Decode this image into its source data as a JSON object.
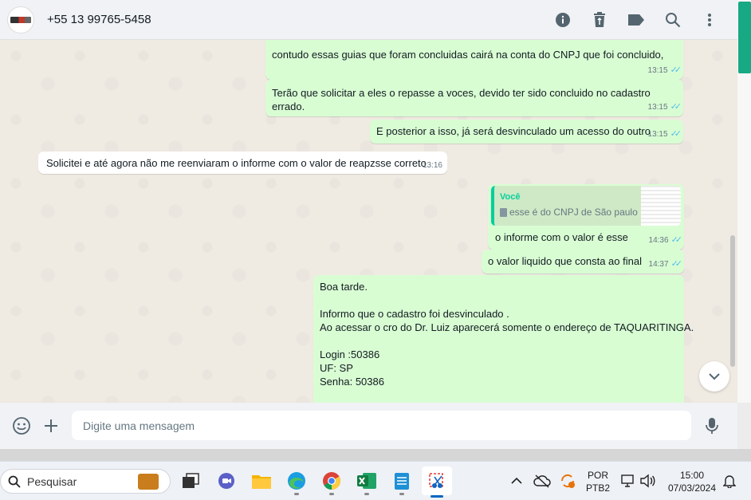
{
  "header": {
    "contact_name": "+55 13 99765-5458",
    "icons": [
      "info-icon",
      "trash-icon",
      "label-icon",
      "search-icon",
      "more-vert-icon"
    ]
  },
  "messages": [
    {
      "direction": "out",
      "text": "contudo essas guias que foram concluidas cairá na conta do CNPJ que foi concluido,",
      "time": "13:15",
      "status": "read"
    },
    {
      "direction": "out",
      "text": "Terão que solicitar a eles o repasse a voces, devido ter sido concluido no cadastro errado.",
      "time": "13:15",
      "status": "read"
    },
    {
      "direction": "out",
      "text": "E posterior a isso, já será desvinculado um acesso do outro",
      "time": "13:15",
      "status": "read"
    },
    {
      "direction": "in",
      "text": "Solicitei e até agora não me reenviaram o informe com o valor de reapzsse correto",
      "time": "13:16"
    },
    {
      "direction": "out",
      "quote_author": "Você",
      "quote_text": "esse é do CNPJ de São paulo",
      "time": "14:36",
      "status": "read",
      "text": "o informe com o valor é esse"
    },
    {
      "direction": "out",
      "text": "o valor liquido que consta ao final",
      "time": "14:37",
      "status": "read"
    },
    {
      "direction": "out",
      "lines": [
        "Boa tarde.",
        "",
        "Informo que o cadastro foi desvinculado .",
        "Ao acessar o cro do Dr. Luiz aparecerá  somente o endereço de TAQUARITINGA.",
        "",
        "Login :50386",
        "UF: SP",
        "Senha: 50386"
      ]
    }
  ],
  "composer": {
    "placeholder": "Digite uma mensagem"
  },
  "taskbar": {
    "search_label": "Pesquisar",
    "lang_top": "POR",
    "lang_bottom": "PTB2",
    "time": "15:00",
    "date": "07/03/2024"
  },
  "colors": {
    "outgoing_bubble": "#d9fdd3",
    "incoming_bubble": "#ffffff",
    "read_ticks": "#53bdeb",
    "accent": "#00a884"
  }
}
